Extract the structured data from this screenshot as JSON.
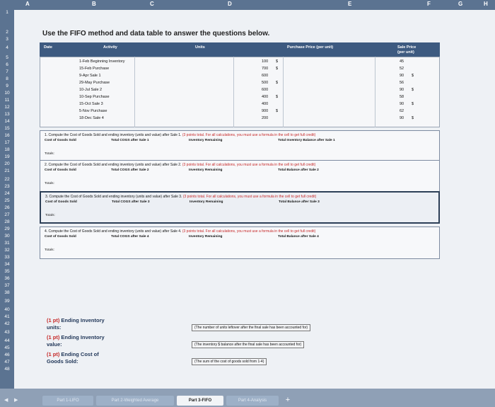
{
  "columns": [
    "A",
    "B",
    "C",
    "D",
    "E",
    "F",
    "G",
    "H"
  ],
  "rows": [
    "1",
    "2",
    "3",
    "4",
    "5",
    "6",
    "7",
    "8",
    "9",
    "10",
    "11",
    "12",
    "13",
    "14",
    "15",
    "16",
    "17",
    "18",
    "19",
    "20",
    "21",
    "22",
    "23",
    "24",
    "25",
    "26",
    "27",
    "28",
    "29",
    "30",
    "31",
    "32",
    "33",
    "34",
    "35",
    "36",
    "37",
    "38",
    "39",
    "40",
    "41",
    "42",
    "43",
    "44",
    "45",
    "46",
    "47",
    "48"
  ],
  "title": "Use the FIFO method and data table to answer the questions below.",
  "table": {
    "headers": {
      "date": "Date",
      "activity": "Activity",
      "units": "Units",
      "purchase_price": "Purchase Price (per unit)",
      "sale_price": "Sale Price",
      "sale_price_sub": "(per unit)"
    },
    "rows": [
      {
        "activity": "1-Feb Beginning Inventory",
        "units": "100",
        "price": "$",
        "sale_price": "",
        "sale_units": "45"
      },
      {
        "activity": "15-Feb Purchase",
        "units": "700",
        "price": "$",
        "sale_price": "",
        "sale_units": "52"
      },
      {
        "activity": "9-Apr Sale 1",
        "units": "600",
        "price": "",
        "sale_price": "$",
        "sale_units": "90"
      },
      {
        "activity": "29-May Purchase",
        "units": "500",
        "price": "$",
        "sale_price": "",
        "sale_units": "56"
      },
      {
        "activity": "10-Jul Sale 2",
        "units": "600",
        "price": "",
        "sale_price": "$",
        "sale_units": "90"
      },
      {
        "activity": "10-Sep Purchase",
        "units": "400",
        "price": "$",
        "sale_price": "",
        "sale_units": "58"
      },
      {
        "activity": "15-Oct Sale 3",
        "units": "400",
        "price": "",
        "sale_price": "$",
        "sale_units": "90"
      },
      {
        "activity": "5-Nov Purchase",
        "units": "900",
        "price": "$",
        "sale_price": "",
        "sale_units": "62"
      },
      {
        "activity": "18-Dec Sale 4",
        "units": "200",
        "price": "",
        "sale_price": "$",
        "sale_units": "90"
      }
    ]
  },
  "questions": [
    {
      "text": "1. Compute the Cost of Goods Sold and ending inventory (units and value) after Sale 1.",
      "points": "(3 points total. For all calculations, you must use a formula in the cell to get full credit)",
      "cols": [
        "Cost of Goods Sold",
        "Total COGS after Sale 1",
        "Inventory Remaining",
        "Total Inventory Balance after Sale 1"
      ],
      "totals": "Totals:"
    },
    {
      "text": "2. Compute the Cost of Goods Sold and ending inventory (units and value) after Sale 2.",
      "points": "(3 points total. For all calculations, you must use a formula in the cell to get full credit)",
      "cols": [
        "Cost of Goods Sold",
        "Total COGS after Sale 2",
        "Inventory Remaining",
        "Total Balance after Sale 2"
      ],
      "totals": "Totals:"
    },
    {
      "text": "3. Compute the Cost of Goods Sold and ending inventory (units and value) after Sale 3.",
      "points": "(3 points total. For all calculations, you must use a formula in the cell to get full credit)",
      "cols": [
        "Cost of Goods Sold",
        "Total COGS after Sale 3",
        "Inventory Remaining",
        "Total Balance after Sale 3"
      ],
      "totals": "Totals:"
    },
    {
      "text": "4. Compute the Cost of Goods Sold and ending inventory (units and value) after Sale 4.",
      "points": "(3 points total. For all calculations, you must use a formula in the cell to get full credit)",
      "cols": [
        "Cost of Goods Sold",
        "Total COGS after Sale 4",
        "Inventory Remaining",
        "Total Balance after Sale 4"
      ],
      "totals": "Totals:"
    }
  ],
  "answers": [
    {
      "pts": "(1 pt)",
      "label1": " Ending Inventory",
      "label2": "units:",
      "hint": "(The number of units leftover after the final sale has been accounted for)"
    },
    {
      "pts": "(1 pt)",
      "label1": " Ending Inventory",
      "label2": "value:",
      "hint": "(The inventory $ balance after the final sale has been accounted for)"
    },
    {
      "pts": "(1 pt)",
      "label1": " Ending Cost of",
      "label2": "Goods Sold:",
      "hint": "(The sum of the cost of goods sold from 1-4)"
    }
  ],
  "tabs": [
    "Part 1-LIFO",
    "Part 2-Weighted Average",
    "Part 3-FIFO",
    "Part 4-Analysis"
  ],
  "active_tab": "Part 3-FIFO",
  "add_tab": "+"
}
